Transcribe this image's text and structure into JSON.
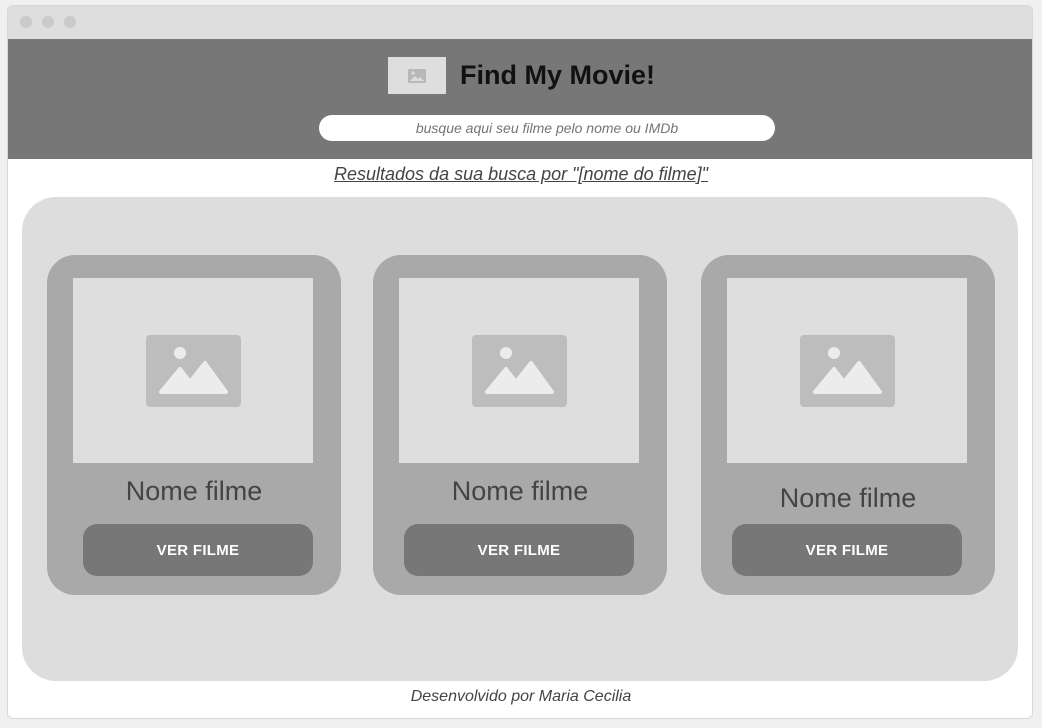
{
  "header": {
    "title": "Find My Movie!",
    "logo_icon": "image-placeholder-icon",
    "search_placeholder": "busque aqui seu filme pelo nome ou IMDb"
  },
  "results": {
    "title": "Resultados da sua busca por \"[nome do filme]\""
  },
  "cards": [
    {
      "title": "Nome filme",
      "button": "VER FILME",
      "image_icon": "image-placeholder-icon"
    },
    {
      "title": "Nome filme",
      "button": "VER FILME",
      "image_icon": "image-placeholder-icon"
    },
    {
      "title": "Nome filme",
      "button": "VER FILME",
      "image_icon": "image-placeholder-icon"
    }
  ],
  "footer": {
    "text": "Desenvolvido por Maria Cecilia"
  },
  "colors": {
    "header_bg": "#777777",
    "panel_bg": "#dddddd",
    "card_bg": "#a9a9a9",
    "button_bg": "#777777"
  }
}
